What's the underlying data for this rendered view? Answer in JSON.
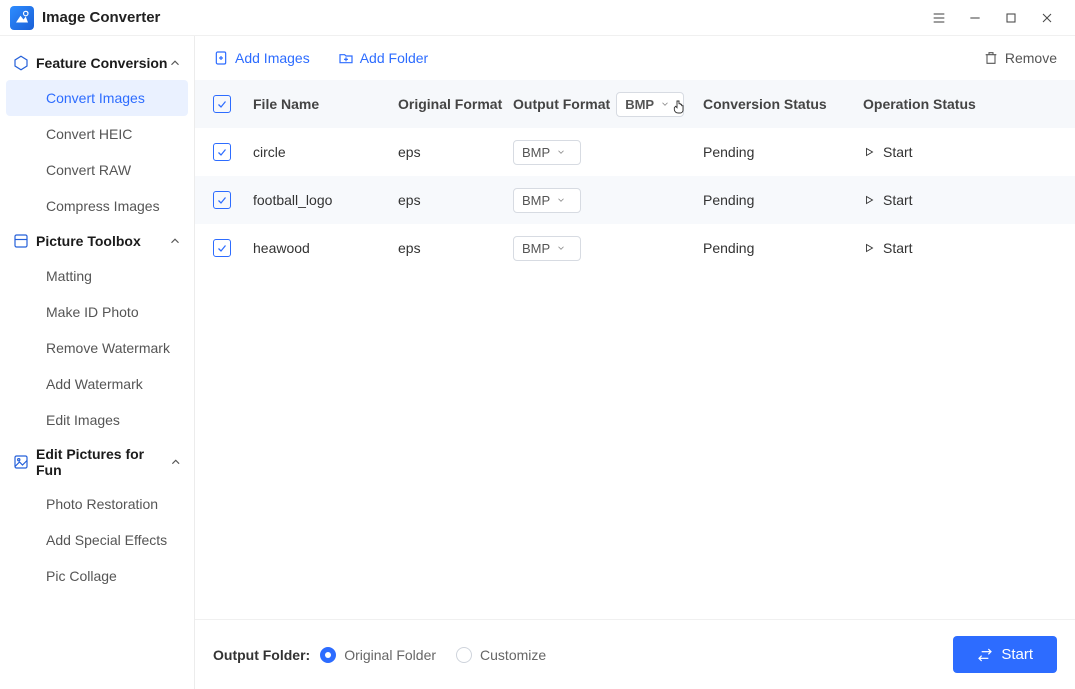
{
  "app_title": "Image Converter",
  "window": {
    "menu_icon": "menu-icon",
    "minimize_icon": "minimize-icon",
    "maximize_icon": "maximize-icon",
    "close_icon": "close-icon"
  },
  "sidebar": {
    "groups": [
      {
        "label": "Feature Conversion",
        "items": [
          {
            "label": "Convert Images",
            "active": true
          },
          {
            "label": "Convert HEIC"
          },
          {
            "label": "Convert RAW"
          },
          {
            "label": "Compress Images"
          }
        ]
      },
      {
        "label": "Picture Toolbox",
        "items": [
          {
            "label": "Matting"
          },
          {
            "label": "Make ID Photo"
          },
          {
            "label": "Remove Watermark"
          },
          {
            "label": "Add Watermark"
          },
          {
            "label": "Edit Images"
          }
        ]
      },
      {
        "label": "Edit Pictures for Fun",
        "items": [
          {
            "label": "Photo Restoration"
          },
          {
            "label": "Add Special Effects"
          },
          {
            "label": "Pic Collage"
          }
        ]
      }
    ]
  },
  "toolbar": {
    "add_images": "Add Images",
    "add_folder": "Add Folder",
    "remove": "Remove"
  },
  "table": {
    "headers": {
      "file_name": "File Name",
      "original_format": "Original Format",
      "output_format": "Output Format",
      "conversion_status": "Conversion Status",
      "operation_status": "Operation Status",
      "header_output_value": "BMP"
    },
    "rows": [
      {
        "name": "circle",
        "orig": "eps",
        "out": "BMP",
        "conv": "Pending",
        "op": "Start"
      },
      {
        "name": "football_logo",
        "orig": "eps",
        "out": "BMP",
        "conv": "Pending",
        "op": "Start"
      },
      {
        "name": "heawood",
        "orig": "eps",
        "out": "BMP",
        "conv": "Pending",
        "op": "Start"
      }
    ]
  },
  "footer": {
    "label": "Output Folder:",
    "option_original": "Original Folder",
    "option_customize": "Customize",
    "start": "Start"
  }
}
